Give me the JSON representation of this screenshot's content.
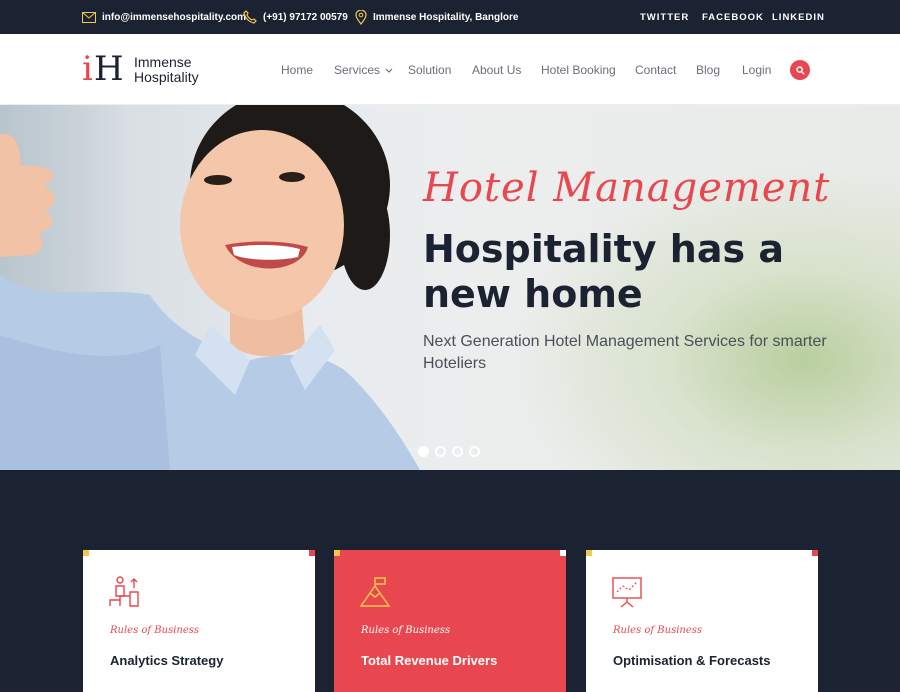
{
  "topbar": {
    "email": "info@immensehospitality.com",
    "phone": "(+91) 97172 00579",
    "location": "Immense Hospitality, Banglore",
    "social": [
      "TWITTER",
      "FACEBOOK",
      "LINKEDIN"
    ]
  },
  "brand": {
    "mark_i": "i",
    "mark_H": "H",
    "line1": "Immense",
    "line2": "Hospitality"
  },
  "nav": {
    "items": [
      "Home",
      "Services",
      "Solution",
      "About Us",
      "Hotel Booking",
      "Contact",
      "Blog",
      "Login"
    ]
  },
  "hero": {
    "kicker": "Hotel Management",
    "title": "Hospitality has a new home",
    "subtitle": "Next Generation Hotel Management Services for smarter Hoteliers",
    "slides_count": 4,
    "active_slide": 1
  },
  "cards": [
    {
      "kicker": "Rules of Business",
      "title": "Analytics Strategy",
      "icon": "analytics-icon"
    },
    {
      "kicker": "Rules of Business",
      "title": "Total Revenue Drivers",
      "icon": "mountain-flag-icon"
    },
    {
      "kicker": "Rules of Business",
      "title": "Optimisation & Forecasts",
      "icon": "presentation-board-icon"
    }
  ],
  "colors": {
    "accent": "#e8474f",
    "dark": "#1b2231",
    "yellow": "#f2c94c"
  }
}
